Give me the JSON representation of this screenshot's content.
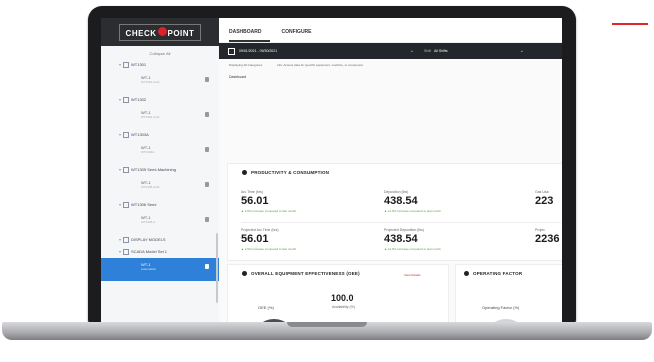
{
  "brand": {
    "logo_text_left": "CHECK",
    "logo_badge": "",
    "logo_text_right": "POINT",
    "accent_color": "#d8232a"
  },
  "sidebar": {
    "collapse_label": "Collapse All",
    "tree": [
      {
        "type": "group",
        "label": "WT1301"
      },
      {
        "type": "child",
        "label": "WT-1",
        "sub": "WT1301-A-01"
      },
      {
        "type": "group",
        "label": "WT1302"
      },
      {
        "type": "child",
        "label": "WT-1",
        "sub": "WT1302-A-01"
      },
      {
        "type": "group",
        "label": "WT1303A"
      },
      {
        "type": "child",
        "label": "WT-1",
        "sub": "WT1303A"
      },
      {
        "type": "group",
        "label": "WT1305 Semi-Machining"
      },
      {
        "type": "child",
        "label": "WT-1",
        "sub": "WT1305-A-01"
      },
      {
        "type": "group",
        "label": "WT1306 Semi"
      },
      {
        "type": "child",
        "label": "WT-1",
        "sub": "WT1306-A"
      },
      {
        "type": "group",
        "label": "DISPLAY MODELS"
      },
      {
        "type": "group",
        "label": "SCADA Model Set 1"
      },
      {
        "type": "child",
        "label": "WT-1",
        "sub": "Automation",
        "selected": true
      }
    ]
  },
  "tabs": [
    {
      "label": "DASHBOARD",
      "active": true
    },
    {
      "label": "CONFIGURE",
      "active": false
    }
  ],
  "filters": {
    "date_range": "09/01/2021 - 09/30/2021",
    "shift_label": "Shift",
    "shift_value": "All Shifts"
  },
  "info": {
    "displaying": "Displaying",
    "category": "All Categories",
    "note": "Info: Access data for specific equipment, machine, or component"
  },
  "dashboard_label": "Dashboard",
  "productivity": {
    "title": "PRODUCTIVITY & CONSUMPTION",
    "metrics": [
      {
        "label": "Arc Time (hrs)",
        "value": "56.01",
        "delta": "▲ 2.5% Increase compared to last month"
      },
      {
        "label": "Deposition (lbs)",
        "value": "438.54",
        "delta": "▲ 12.6% Increase compared to last month"
      },
      {
        "label": "Gas Usa",
        "value": "223",
        "delta": ""
      },
      {
        "label": "Projected Arc Time (hrs)",
        "value": "56.01",
        "delta": "▲ 2.5% Increase compared to last month"
      },
      {
        "label": "Projected Deposition (lbs)",
        "value": "438.54",
        "delta": "▲ 12.6% Increase compared to last month"
      },
      {
        "label": "Projec",
        "value": "2236",
        "delta": ""
      }
    ]
  },
  "oee": {
    "title": "OVERALL EQUIPMENT EFFECTIVENESS (OEE)",
    "link": "View Details",
    "gauge_label": "OEE (%)",
    "availability_value": "100.0",
    "availability_label": "Availability (%)"
  },
  "operating": {
    "title": "OPERATING FACTOR",
    "gauge_label": "Operating Factor (%)"
  }
}
